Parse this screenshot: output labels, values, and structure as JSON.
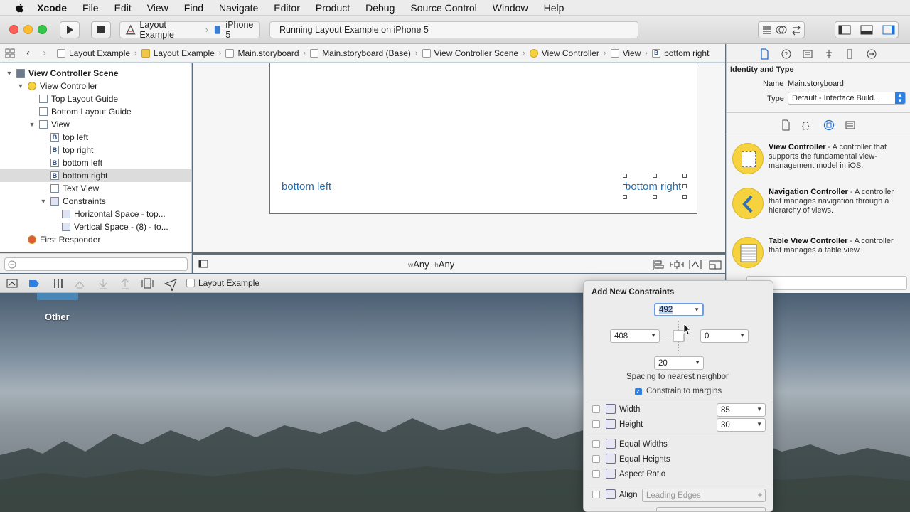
{
  "menubar": {
    "app": "Xcode",
    "items": [
      "File",
      "Edit",
      "View",
      "Find",
      "Navigate",
      "Editor",
      "Product",
      "Debug",
      "Source Control",
      "Window",
      "Help"
    ]
  },
  "toolbar": {
    "scheme": "Layout Example",
    "device": "iPhone 5",
    "activity": "Running Layout Example on iPhone 5"
  },
  "jumpbar": {
    "crumbs": [
      "Layout Example",
      "Layout Example",
      "Main.storyboard",
      "Main.storyboard (Base)",
      "View Controller Scene",
      "View Controller",
      "View",
      "bottom right"
    ]
  },
  "navigator": {
    "rows": [
      {
        "label": "View Controller Scene",
        "bold": true,
        "indent": 0,
        "tri": "▼",
        "icon": "scene"
      },
      {
        "label": "View Controller",
        "indent": 1,
        "tri": "▼",
        "icon": "vc"
      },
      {
        "label": "Top Layout Guide",
        "indent": 2,
        "tri": "",
        "icon": "guide"
      },
      {
        "label": "Bottom Layout Guide",
        "indent": 2,
        "tri": "",
        "icon": "guide"
      },
      {
        "label": "View",
        "indent": 2,
        "tri": "▼",
        "icon": "view"
      },
      {
        "label": "top left",
        "indent": 3,
        "tri": "",
        "icon": "B"
      },
      {
        "label": "top right",
        "indent": 3,
        "tri": "",
        "icon": "B"
      },
      {
        "label": "bottom left",
        "indent": 3,
        "tri": "",
        "icon": "B"
      },
      {
        "label": "bottom right",
        "indent": 3,
        "tri": "",
        "icon": "B",
        "selected": true
      },
      {
        "label": "Text View",
        "indent": 3,
        "tri": "",
        "icon": "text"
      },
      {
        "label": "Constraints",
        "indent": 3,
        "tri": "▼",
        "icon": "constraint"
      },
      {
        "label": "Horizontal Space - top...",
        "indent": 4,
        "tri": "",
        "icon": "constraint"
      },
      {
        "label": "Vertical Space - (8) - to...",
        "indent": 4,
        "tri": "",
        "icon": "constraint"
      },
      {
        "label": "First Responder",
        "indent": 1,
        "tri": "",
        "icon": "responder"
      }
    ]
  },
  "canvas": {
    "bottom_left": "bottom left",
    "bottom_right": "bottom right",
    "size_w": "w",
    "size_any_w": "Any",
    "size_h": "h",
    "size_any_h": "Any"
  },
  "debugbar": {
    "target": "Layout Example"
  },
  "utility": {
    "section": "Identity and Type",
    "name_label": "Name",
    "name_value": "Main.storyboard",
    "type_label": "Type",
    "type_value": "Default - Interface Build...",
    "library": [
      {
        "title": "View Controller",
        "desc": " - A controller that supports the fundamental view-management model in iOS."
      },
      {
        "title": "Navigation Controller",
        "desc": " - A controller that manages navigation through a hierarchy of views."
      },
      {
        "title": "Table View Controller",
        "desc": " - A controller that manages a table view."
      }
    ]
  },
  "desktop": {
    "folder_label": "Other"
  },
  "popover": {
    "title": "Add New Constraints",
    "top": "492",
    "left": "408",
    "right": "0",
    "bottom": "20",
    "spacing_caption": "Spacing to nearest neighbor",
    "constrain_margins": "Constrain to margins",
    "width_label": "Width",
    "width_value": "85",
    "height_label": "Height",
    "height_value": "30",
    "equal_widths": "Equal Widths",
    "equal_heights": "Equal Heights",
    "aspect_ratio": "Aspect Ratio",
    "align_label": "Align",
    "align_value": "Leading Edges"
  },
  "colors": {
    "accent": "#2a6fae",
    "selection": "#dcdcdc",
    "yellow": "#f6d23e"
  }
}
